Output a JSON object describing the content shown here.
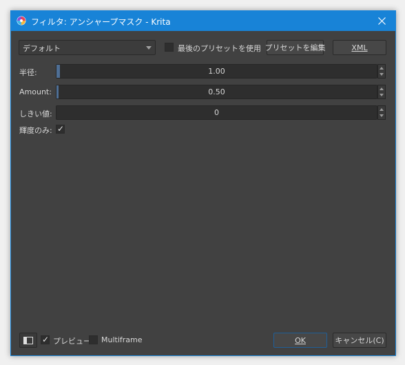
{
  "window": {
    "title": "フィルタ: アンシャープマスク - Krita"
  },
  "toolbar": {
    "preset_select_value": "デフォルト",
    "use_last_preset_label": "最後のプリセットを使用",
    "use_last_preset_checked": false,
    "edit_presets_label": "プリセットを編集",
    "xml_label": "XML"
  },
  "params": [
    {
      "label": "半径:",
      "value": "1.00",
      "fill_fraction": 0.01
    },
    {
      "label": "Amount:",
      "value": "0.50",
      "fill_fraction": 0.005
    },
    {
      "label": "しきい値:",
      "value": "0",
      "fill_fraction": 0
    }
  ],
  "luminance_only": {
    "label": "輝度のみ:",
    "checked": true
  },
  "footer": {
    "preview_label": "プレビュー",
    "preview_checked": true,
    "multiframe_label": "Multiframe",
    "multiframe_checked": false,
    "ok_label": "OK",
    "cancel_label": "キャンセル(C)"
  },
  "colors": {
    "titlebar": "#1883d7",
    "dialog_bg": "#414141",
    "slider_fill": "#4f6f95"
  }
}
